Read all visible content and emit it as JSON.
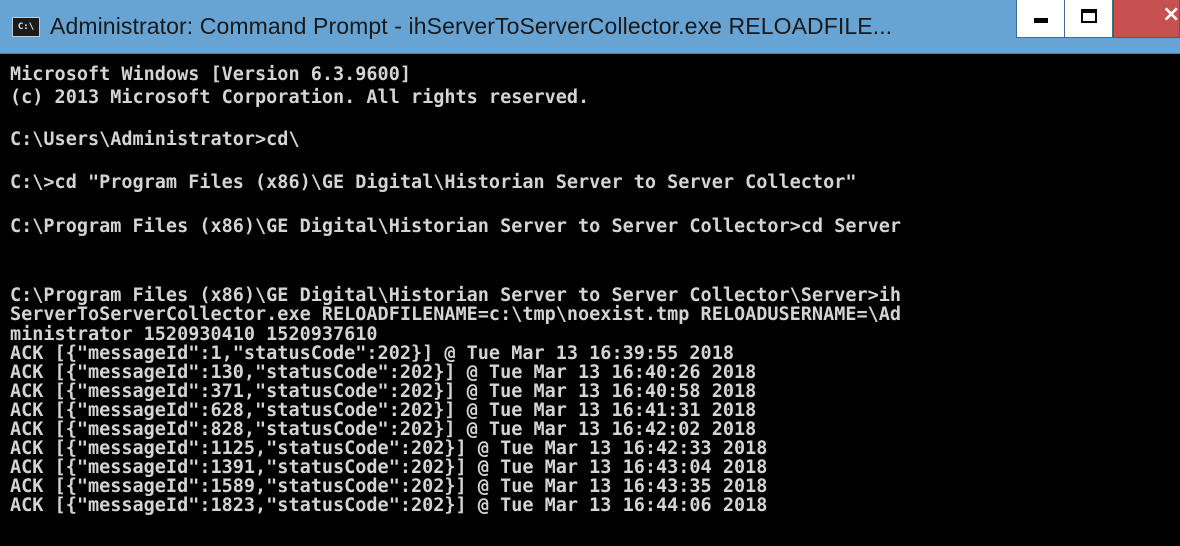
{
  "window": {
    "title": "Administrator: Command Prompt - ihServerToServerCollector.exe  RELOADFILE...",
    "icon": "cmd-icon",
    "controls": {
      "minimize": "minimize-icon",
      "maximize": "maximize-icon",
      "close": "close-icon"
    },
    "colors": {
      "titlebar": "#68a4d3",
      "console_bg": "#000000",
      "console_text": "#d4d4d4",
      "close_button": "#c75050"
    }
  },
  "console": {
    "lines": [
      "Microsoft Windows [Version 6.3.9600]",
      "(c) 2013 Microsoft Corporation. All rights reserved.",
      "C:\\Users\\Administrator>cd\\",
      "C:\\>cd \"Program Files (x86)\\GE Digital\\Historian Server to Server Collector\"",
      "C:\\Program Files (x86)\\GE Digital\\Historian Server to Server Collector>cd Server",
      "C:\\Program Files (x86)\\GE Digital\\Historian Server to Server Collector\\Server>ih",
      "ServerToServerCollector.exe RELOADFILENAME=c:\\tmp\\noexist.tmp RELOADUSERNAME=\\Ad",
      "ministrator 1520930410 1520937610",
      "ACK [{\"messageId\":1,\"statusCode\":202}] @ Tue Mar 13 16:39:55 2018",
      "ACK [{\"messageId\":130,\"statusCode\":202}] @ Tue Mar 13 16:40:26 2018",
      "ACK [{\"messageId\":371,\"statusCode\":202}] @ Tue Mar 13 16:40:58 2018",
      "ACK [{\"messageId\":628,\"statusCode\":202}] @ Tue Mar 13 16:41:31 2018",
      "ACK [{\"messageId\":828,\"statusCode\":202}] @ Tue Mar 13 16:42:02 2018",
      "ACK [{\"messageId\":1125,\"statusCode\":202}] @ Tue Mar 13 16:42:33 2018",
      "ACK [{\"messageId\":1391,\"statusCode\":202}] @ Tue Mar 13 16:43:04 2018",
      "ACK [{\"messageId\":1589,\"statusCode\":202}] @ Tue Mar 13 16:43:35 2018",
      "ACK [{\"messageId\":1823,\"statusCode\":202}] @ Tue Mar 13 16:44:06 2018"
    ]
  }
}
